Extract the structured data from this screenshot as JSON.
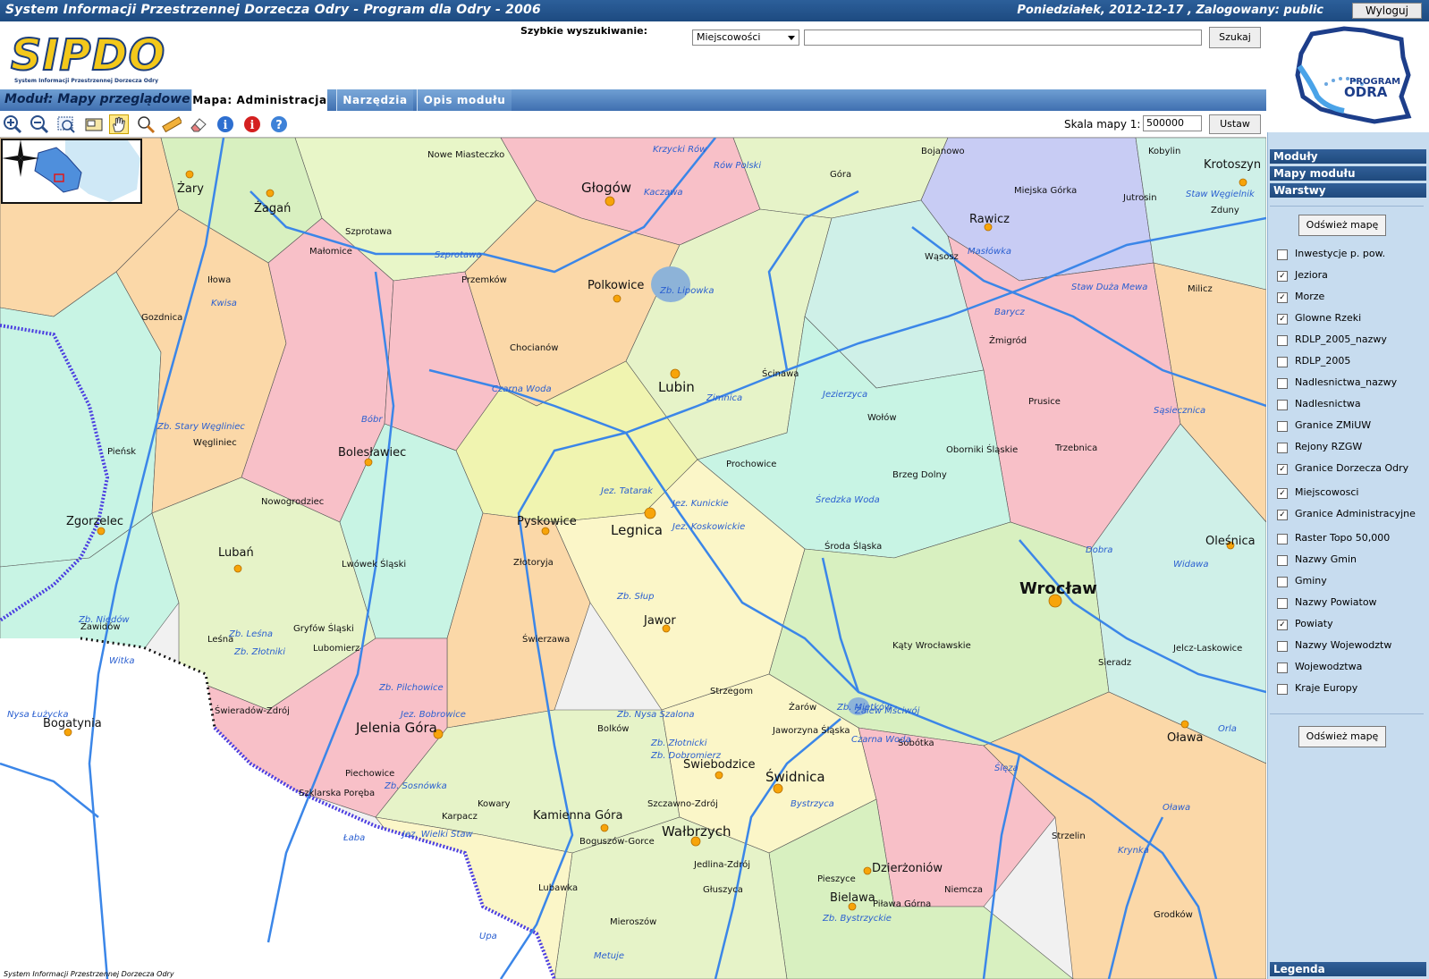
{
  "titlebar": {
    "title": "System Informacji Przestrzennej Dorzecza Odry - Program dla Odry - 2006",
    "status": "Poniedziałek, 2012-12-17 , Zalogowany: public",
    "logout_label": "Wyloguj"
  },
  "logo": {
    "main_text": "SIPDO",
    "sub_text": "System Informacji Przestrzennej Dorzecza Odry",
    "right_logo_line1": "PROGRAM",
    "right_logo_line2": "ODRA"
  },
  "search": {
    "label": "Szybkie wyszukiwanie:",
    "select_value": "Miejscowości",
    "input_value": "",
    "button_label": "Szukaj"
  },
  "module": {
    "label": "Moduł:  Mapy przeglądowe",
    "tabs": [
      {
        "label": "Mapa: Administracja"
      },
      {
        "label": "Narzędzia"
      },
      {
        "label": "Opis modułu"
      }
    ]
  },
  "toolbar": {
    "tools": [
      {
        "icon": "zoom-in-icon"
      },
      {
        "icon": "zoom-out-icon"
      },
      {
        "icon": "zoom-box-icon"
      },
      {
        "icon": "full-extent-icon"
      },
      {
        "icon": "pan-hand-icon"
      },
      {
        "icon": "magnifier-icon"
      },
      {
        "icon": "ruler-icon"
      },
      {
        "icon": "eraser-icon"
      },
      {
        "icon": "info-icon"
      },
      {
        "icon": "identify-icon"
      },
      {
        "icon": "help-icon"
      }
    ],
    "scale_label": "Skala mapy 1:",
    "scale_value": "500000",
    "scale_button": "Ustaw"
  },
  "sidebar": {
    "sections": {
      "modules": "Moduły",
      "module_maps": "Mapy modułu",
      "layers": "Warstwy",
      "legend": "Legenda"
    },
    "refresh_label": "Odśwież mapę",
    "layers": [
      {
        "label": "Inwestycje p. pow.",
        "checked": false
      },
      {
        "label": "Jeziora",
        "checked": true
      },
      {
        "label": "Morze",
        "checked": true
      },
      {
        "label": "Glowne Rzeki",
        "checked": true
      },
      {
        "label": "RDLP_2005_nazwy",
        "checked": false
      },
      {
        "label": "RDLP_2005",
        "checked": false
      },
      {
        "label": "Nadlesnictwa_nazwy",
        "checked": false
      },
      {
        "label": "Nadlesnictwa",
        "checked": false
      },
      {
        "label": "Granice ZMiUW",
        "checked": false
      },
      {
        "label": "Rejony RZGW",
        "checked": false
      },
      {
        "label": "Granice Dorzecza Odry",
        "checked": true
      },
      {
        "label": "Miejscowosci",
        "checked": true
      },
      {
        "label": "Granice Administracyjne",
        "checked": true
      },
      {
        "label": "Raster Topo 50,000",
        "checked": false
      },
      {
        "label": "Nazwy Gmin",
        "checked": false
      },
      {
        "label": "Gminy",
        "checked": false
      },
      {
        "label": "Nazwy Powiatow",
        "checked": false
      },
      {
        "label": "Powiaty",
        "checked": true
      },
      {
        "label": "Nazwy Wojewodztw",
        "checked": false
      },
      {
        "label": "Wojewodztwa",
        "checked": false
      },
      {
        "label": "Kraje Europy",
        "checked": false
      }
    ]
  },
  "map": {
    "footer": "System Informacji Przestrzennej Dorzecza Odry",
    "cities": [
      {
        "name": "Wrocław",
        "size": "big"
      },
      {
        "name": "Legnica",
        "size": "med"
      },
      {
        "name": "Jelenia Góra",
        "size": "med"
      },
      {
        "name": "Wałbrzych",
        "size": "med"
      },
      {
        "name": "Świdnica",
        "size": "med"
      },
      {
        "name": "Głogów",
        "size": "med"
      },
      {
        "name": "Lubin",
        "size": "med"
      },
      {
        "name": "Polkowice",
        "size": "norm"
      },
      {
        "name": "Bolesławiec",
        "size": "norm"
      },
      {
        "name": "Zgorzelec",
        "size": "norm"
      },
      {
        "name": "Lubań",
        "size": "norm"
      },
      {
        "name": "Pyskowice",
        "size": "norm"
      },
      {
        "name": "Jawor",
        "size": "norm"
      },
      {
        "name": "Kamienna Góra",
        "size": "norm"
      },
      {
        "name": "Dzierżoniów",
        "size": "norm"
      },
      {
        "name": "Bielawa",
        "size": "norm"
      },
      {
        "name": "Oława",
        "size": "norm"
      },
      {
        "name": "Oleśnica",
        "size": "norm"
      },
      {
        "name": "Rawicz",
        "size": "norm"
      },
      {
        "name": "Krotoszyn",
        "size": "norm"
      },
      {
        "name": "Żagań",
        "size": "norm"
      },
      {
        "name": "Żary",
        "size": "norm"
      },
      {
        "name": "Bogatynia",
        "size": "norm"
      },
      {
        "name": "Świebodzice",
        "size": "norm"
      },
      {
        "name": "Żmigród",
        "size": "small"
      },
      {
        "name": "Trzebnica",
        "size": "small"
      },
      {
        "name": "Oborniki Śląskie",
        "size": "small"
      },
      {
        "name": "Brzeg Dolny",
        "size": "small"
      },
      {
        "name": "Środa Śląska",
        "size": "small"
      },
      {
        "name": "Kąty Wrocławskie",
        "size": "small"
      },
      {
        "name": "Sobótka",
        "size": "small"
      },
      {
        "name": "Strzelin",
        "size": "small"
      },
      {
        "name": "Jelcz-Laskowice",
        "size": "small"
      },
      {
        "name": "Milicz",
        "size": "small"
      },
      {
        "name": "Wołów",
        "size": "small"
      },
      {
        "name": "Ścinawa",
        "size": "small"
      },
      {
        "name": "Chocianów",
        "size": "small"
      },
      {
        "name": "Przemków",
        "size": "small"
      },
      {
        "name": "Szprotawa",
        "size": "small"
      },
      {
        "name": "Lwówek Śląski",
        "size": "small"
      },
      {
        "name": "Złotoryja",
        "size": "small"
      },
      {
        "name": "Gryfów Śląski",
        "size": "small"
      },
      {
        "name": "Świeradów-Zdrój",
        "size": "small"
      },
      {
        "name": "Piechowice",
        "size": "small"
      },
      {
        "name": "Szklarska Poręba",
        "size": "small"
      },
      {
        "name": "Karpacz",
        "size": "small"
      },
      {
        "name": "Kowary",
        "size": "small"
      },
      {
        "name": "Bolków",
        "size": "small"
      },
      {
        "name": "Strzegom",
        "size": "small"
      },
      {
        "name": "Żarów",
        "size": "small"
      },
      {
        "name": "Jaworzyna Śląska",
        "size": "small"
      },
      {
        "name": "Szczawno-Zdrój",
        "size": "small"
      },
      {
        "name": "Boguszów-Gorce",
        "size": "small"
      },
      {
        "name": "Jedlina-Zdrój",
        "size": "small"
      },
      {
        "name": "Głuszyca",
        "size": "small"
      },
      {
        "name": "Lubawka",
        "size": "small"
      },
      {
        "name": "Pieszyce",
        "size": "small"
      },
      {
        "name": "Piława Górna",
        "size": "small"
      },
      {
        "name": "Niemcza",
        "size": "small"
      },
      {
        "name": "Grodków",
        "size": "small"
      },
      {
        "name": "Góra",
        "size": "small"
      },
      {
        "name": "Jutrosin",
        "size": "small"
      },
      {
        "name": "Miejska Górka",
        "size": "small"
      },
      {
        "name": "Kobylin",
        "size": "small"
      },
      {
        "name": "Zduny",
        "size": "small"
      },
      {
        "name": "Bojanowo",
        "size": "small"
      },
      {
        "name": "Wąsosz",
        "size": "small"
      },
      {
        "name": "Nowe Miasteczko",
        "size": "small"
      },
      {
        "name": "Małomice",
        "size": "small"
      },
      {
        "name": "Iłowa",
        "size": "small"
      },
      {
        "name": "Gozdnica",
        "size": "small"
      },
      {
        "name": "Węgliniec",
        "size": "small"
      },
      {
        "name": "Pieńsk",
        "size": "small"
      },
      {
        "name": "Nowogrodziec",
        "size": "small"
      },
      {
        "name": "Leśna",
        "size": "small"
      },
      {
        "name": "Lubomierz",
        "size": "small"
      },
      {
        "name": "Zawidów",
        "size": "small"
      },
      {
        "name": "Świerzawa",
        "size": "small"
      },
      {
        "name": "Prochowice",
        "size": "small"
      },
      {
        "name": "Prusice",
        "size": "small"
      },
      {
        "name": "Sieradz",
        "size": "small"
      },
      {
        "name": "Mieroszów",
        "size": "small"
      }
    ],
    "rivers": [
      "Zb. Lipowka",
      "Zb. Stary Węgliniec",
      "Jez. Tatarak",
      "Jez. Kunickie",
      "Jez. Koskowickie",
      "Zb. Słup",
      "Zb. Złotnicki",
      "Zb. Mietków",
      "Zb. Pilchowice",
      "Zb. Sosnówka",
      "Jez. Bobrowice",
      "Zb. Dobromierz",
      "Zb. Nysa Szalona",
      "Zb. Bystrzyckie",
      "Staw Węgielnik",
      "Staw Duża Mewa",
      "Krzycki Rów",
      "Zb. Niedów",
      "Zb. Leśna",
      "Zb. Złotniki",
      "Czarna Woda",
      "Zimnica",
      "Średzka Woda",
      "Bystrzyca",
      "Nysa Łużycka",
      "Kwisa",
      "Bóbr",
      "Kaczawa",
      "Barycz",
      "Widawa",
      "Oława",
      "Ślęza",
      "Krynka",
      "Łaba",
      "Upa",
      "Metuje",
      "Jez. Wielki Staw",
      "Czarna Woda",
      "Witka",
      "Szprotawa",
      "Sąsiecznica",
      "Jezierzyca",
      "Rów Polski",
      "Dobra",
      "Orla",
      "Masłówka",
      "Zalew Mściwój"
    ]
  }
}
